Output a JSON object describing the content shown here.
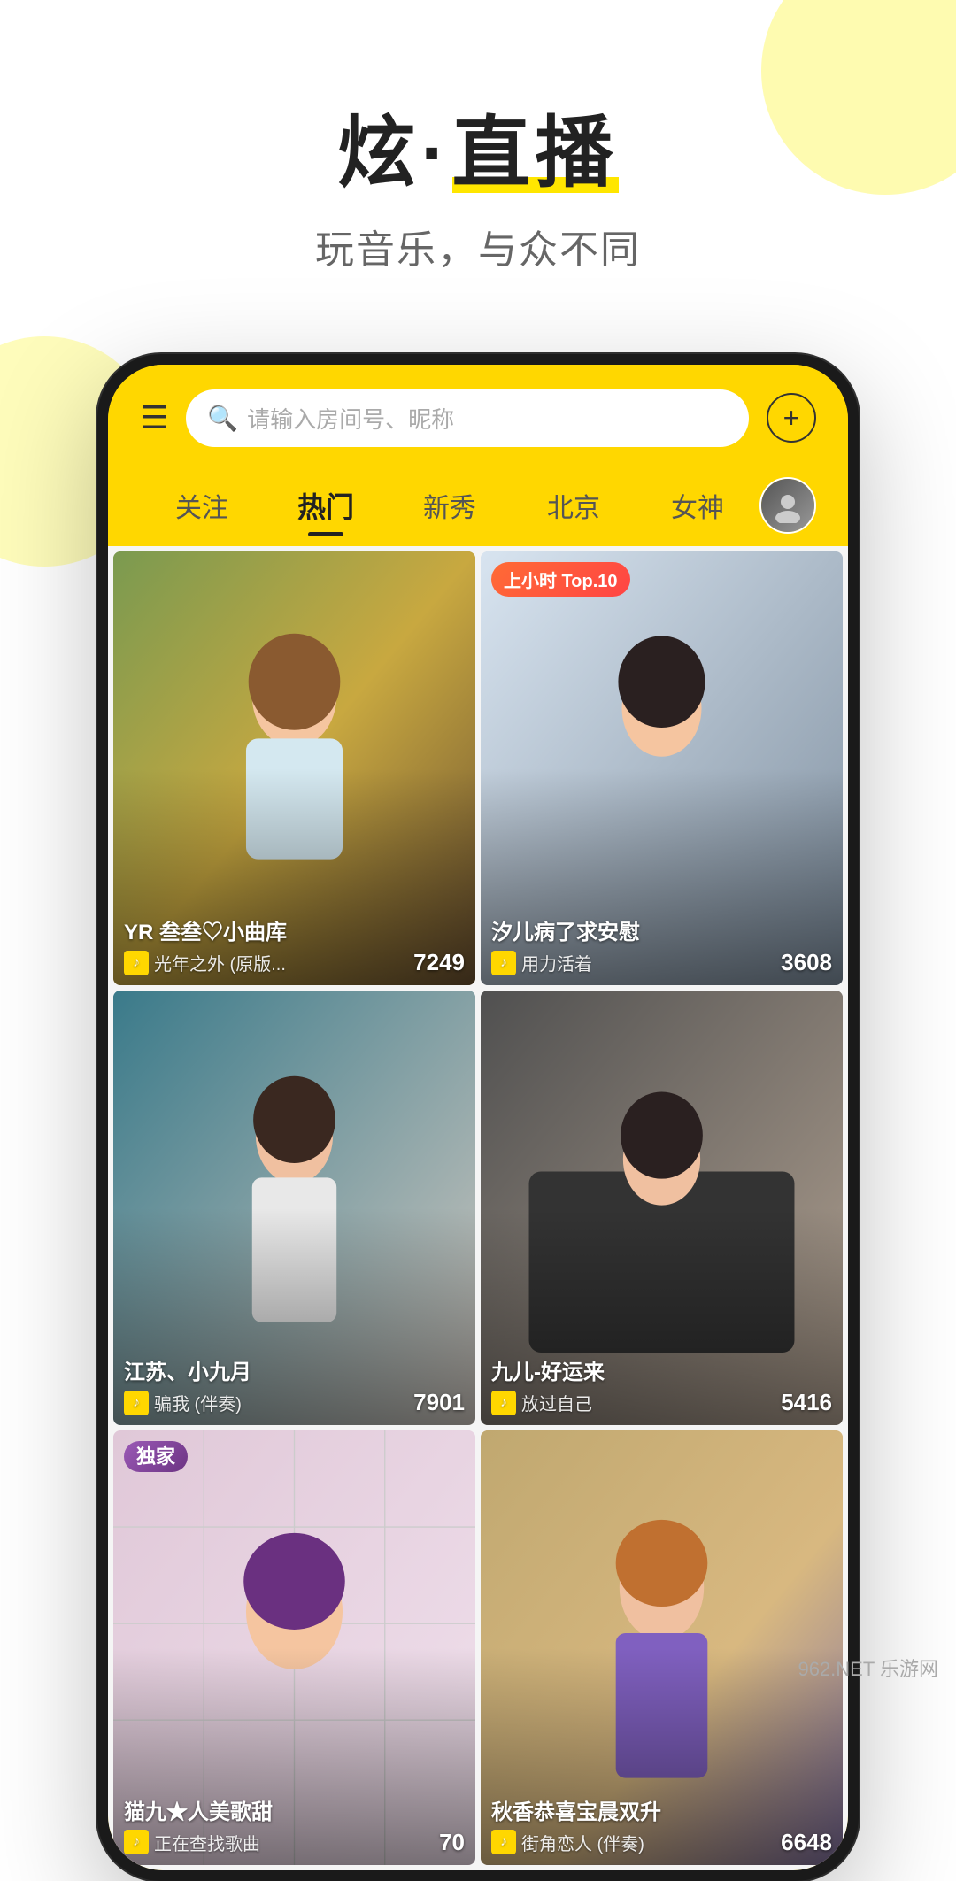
{
  "background": {
    "circleTopRight": "decorative yellow circle top right",
    "circleLeft": "decorative yellow circle left"
  },
  "header": {
    "mainTitle1": "炫·",
    "mainTitle2": "直播",
    "subTitle": "玩音乐，与众不同"
  },
  "phone": {
    "searchBar": {
      "placeholder": "请输入房间号、昵称",
      "searchIconChar": "🔍"
    },
    "plusButton": "+",
    "hamburgerChar": "☰",
    "navTabs": [
      {
        "label": "关注",
        "active": false
      },
      {
        "label": "热门",
        "active": true
      },
      {
        "label": "新秀",
        "active": false
      },
      {
        "label": "北京",
        "active": false
      },
      {
        "label": "女神",
        "active": false
      }
    ],
    "streamers": [
      {
        "id": 1,
        "name": "YR 叁叁♡小曲库",
        "song": "光年之外 (原版...",
        "viewers": "7249",
        "badge": null,
        "bgColor": "linear-gradient(135deg, #5a7a3a 0%, #8aad5a 30%, #c4a84a 70%, #b8862a 100%)",
        "imageDesc": "girl in hammock outdoor"
      },
      {
        "id": 2,
        "name": "汐儿病了求安慰",
        "song": "用力活着",
        "viewers": "3608",
        "badge": "上小时 Top.10",
        "bgColor": "linear-gradient(135deg, #c8d4e0 0%, #a8b8c8 40%, #708090 100%)",
        "imageDesc": "girl leaning on arms"
      },
      {
        "id": 3,
        "name": "江苏、小九月",
        "song": "骗我 (伴奏)",
        "viewers": "7901",
        "badge": null,
        "bgColor": "linear-gradient(135deg, #3a7a8a 0%, #5a9aaa 40%, #e8e0d8 100%)",
        "imageDesc": "girl in white jacket"
      },
      {
        "id": 4,
        "name": "九儿-好运来",
        "song": "放过自己",
        "viewers": "5416",
        "badge": null,
        "bgColor": "linear-gradient(135deg, #606060 0%, #888 40%, #c0b0a0 100%)",
        "imageDesc": "girl in car"
      },
      {
        "id": 5,
        "name": "猫九★人美歌甜",
        "song": "正在查找歌曲",
        "viewers": "70",
        "badge": "独家",
        "bgColor": "linear-gradient(135deg, #d4c0d0 0%, #f0d0e0 50%, #e8c8d8 100%)",
        "imageDesc": "girl cute pose"
      },
      {
        "id": 6,
        "name": "秋香恭喜宝晨双升",
        "song": "街角恋人 (伴奏)",
        "viewers": "6648",
        "badge": null,
        "bgColor": "linear-gradient(135deg, #d0a870 0%, #e8c890 40%, #9080a0 100%)",
        "imageDesc": "girl with orange hair"
      }
    ]
  },
  "watermark": "962.NET 乐游网",
  "icons": {
    "hamburger": "☰",
    "search": "○",
    "plus": "+",
    "music": "♪"
  }
}
